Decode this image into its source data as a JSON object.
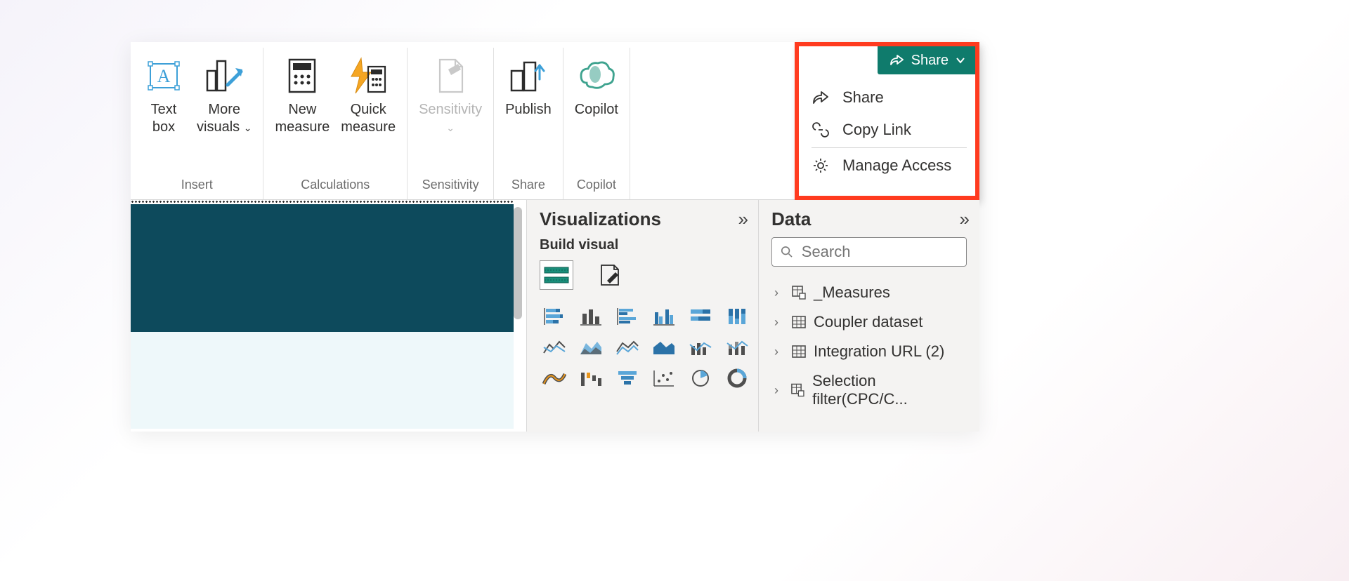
{
  "ribbon": {
    "groups": {
      "insert": {
        "title": "Insert",
        "text_box": "Text\nbox",
        "more_visuals": "More\nvisuals"
      },
      "calculations": {
        "title": "Calculations",
        "new_measure": "New\nmeasure",
        "quick_measure": "Quick\nmeasure"
      },
      "sensitivity": {
        "title": "Sensitivity",
        "sensitivity": "Sensitivity"
      },
      "share": {
        "title": "Share",
        "publish": "Publish"
      },
      "copilot": {
        "title": "Copilot",
        "copilot": "Copilot"
      }
    }
  },
  "share_panel": {
    "button": "Share",
    "items": {
      "share": "Share",
      "copy_link": "Copy Link",
      "manage_access": "Manage Access"
    }
  },
  "panes": {
    "visualizations": {
      "title": "Visualizations",
      "subtitle": "Build visual"
    },
    "data": {
      "title": "Data",
      "search_placeholder": "Search",
      "tree": [
        "_Measures",
        "Coupler dataset",
        "Integration URL (2)",
        "Selection filter(CPC/C..."
      ]
    }
  }
}
